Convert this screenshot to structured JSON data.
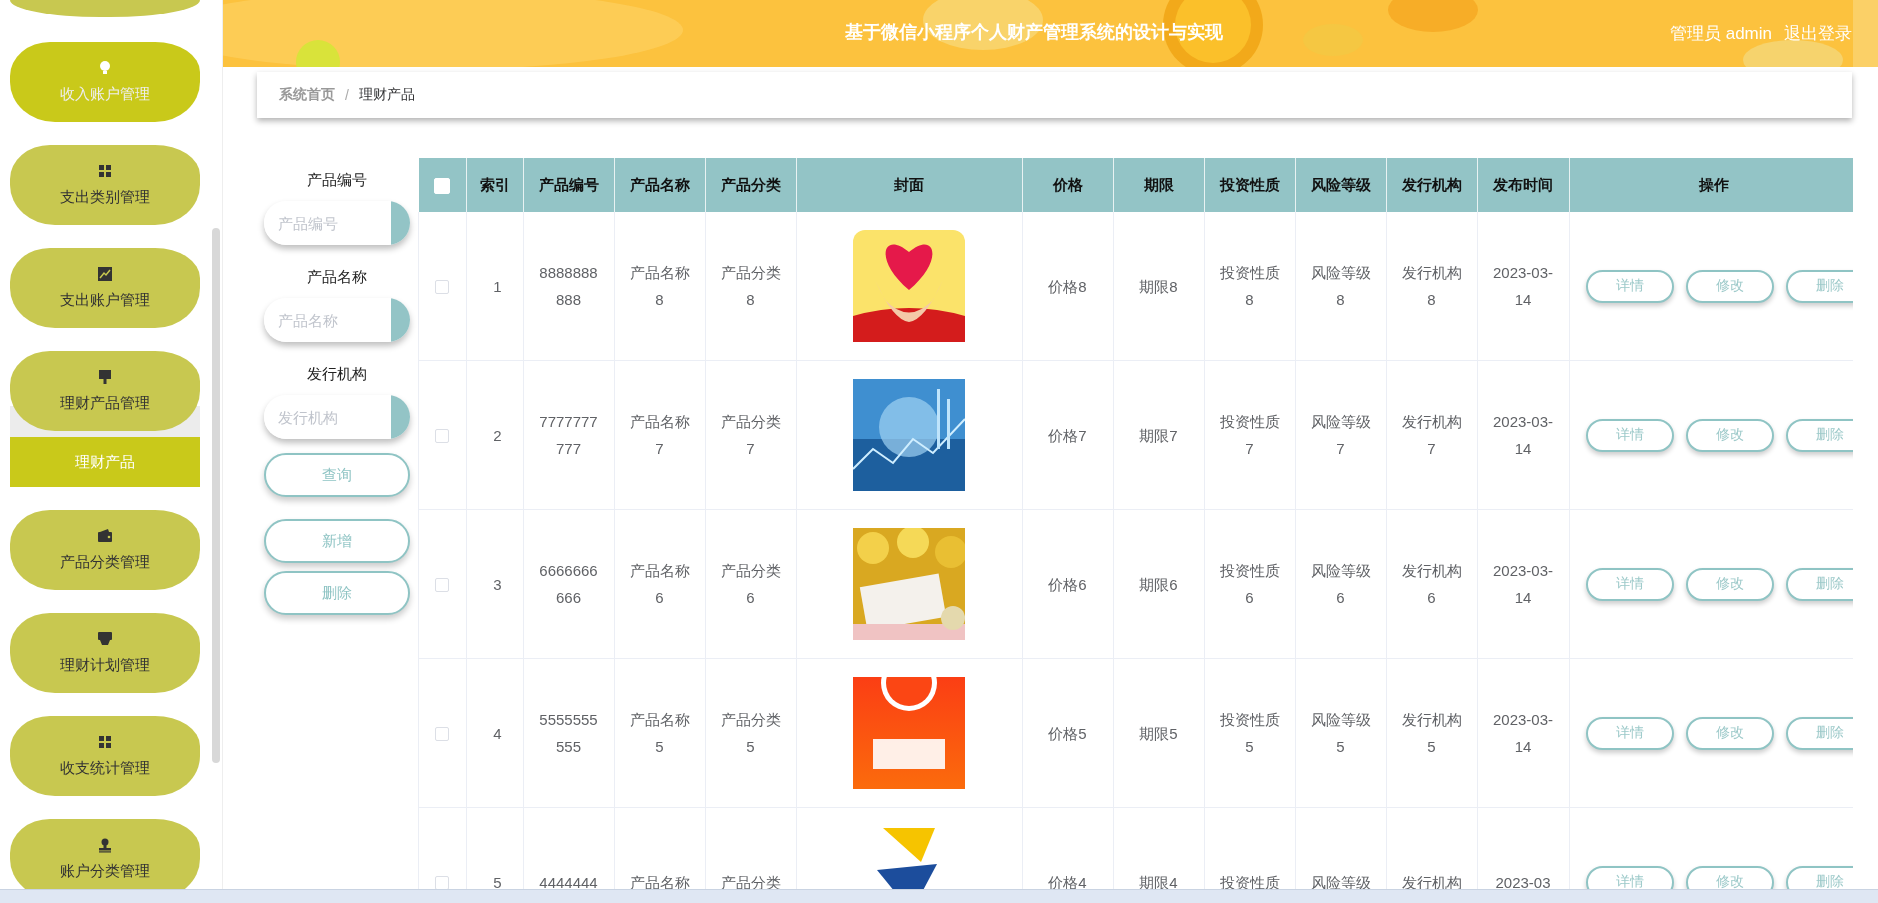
{
  "header": {
    "title": "基于微信小程序个人财产管理系统的设计与实现",
    "user": "管理员 admin",
    "logout": "退出登录"
  },
  "breadcrumb": [
    {
      "label": "系统首页",
      "current": false
    },
    {
      "label": "理财产品",
      "current": true
    }
  ],
  "breadcrumb_separator": "/",
  "sidebar": {
    "items": [
      {
        "label": "收入账户管理",
        "selected": true,
        "expanded": false
      },
      {
        "label": "支出类别管理",
        "selected": false,
        "expanded": false
      },
      {
        "label": "支出账户管理",
        "selected": false,
        "expanded": false
      },
      {
        "label": "理财产品管理",
        "selected": false,
        "expanded": true,
        "children": [
          {
            "label": "理财产品",
            "selected": true
          }
        ]
      },
      {
        "label": "产品分类管理",
        "selected": false,
        "expanded": false
      },
      {
        "label": "理财计划管理",
        "selected": false,
        "expanded": false
      },
      {
        "label": "收支统计管理",
        "selected": false,
        "expanded": false
      },
      {
        "label": "账户分类管理",
        "selected": false,
        "expanded": false
      }
    ]
  },
  "search": {
    "fields": [
      {
        "label": "产品编号",
        "placeholder": "产品编号"
      },
      {
        "label": "产品名称",
        "placeholder": "产品名称"
      },
      {
        "label": "发行机构",
        "placeholder": "发行机构"
      }
    ],
    "query_button": "查询",
    "buttons": [
      "新增",
      "删除"
    ]
  },
  "table": {
    "select_all": false,
    "columns": [
      {
        "kind": "check"
      },
      {
        "kind": "text",
        "label": "索引"
      },
      {
        "kind": "text",
        "label": "产品编号"
      },
      {
        "kind": "text",
        "label": "产品名称"
      },
      {
        "kind": "text",
        "label": "产品分类"
      },
      {
        "kind": "cover",
        "label": "封面"
      },
      {
        "kind": "text",
        "label": "价格"
      },
      {
        "kind": "text",
        "label": "期限"
      },
      {
        "kind": "text",
        "label": "投资性质"
      },
      {
        "kind": "text",
        "label": "风险等级"
      },
      {
        "kind": "text",
        "label": "发行机构"
      },
      {
        "kind": "text",
        "label": "发布时间"
      },
      {
        "kind": "actions",
        "label": "操作"
      }
    ],
    "rows": [
      {
        "selected": false,
        "cells": [
          "",
          "1",
          "8888888888",
          "产品名称8",
          "产品分类8",
          {
            "kind": "picture"
          },
          "价格8",
          "期限8",
          "投资性质8",
          "风险等级8",
          "发行机构8",
          "2023-03-14"
        ],
        "actions": [
          "详情",
          "修改",
          "删除"
        ]
      },
      {
        "selected": false,
        "cells": [
          "",
          "2",
          "7777777777",
          "产品名称7",
          "产品分类7",
          {
            "kind": "picture"
          },
          "价格7",
          "期限7",
          "投资性质7",
          "风险等级7",
          "发行机构7",
          "2023-03-14"
        ],
        "actions": [
          "详情",
          "修改",
          "删除"
        ]
      },
      {
        "selected": false,
        "cells": [
          "",
          "3",
          "6666666666",
          "产品名称6",
          "产品分类6",
          {
            "kind": "picture"
          },
          "价格6",
          "期限6",
          "投资性质6",
          "风险等级6",
          "发行机构6",
          "2023-03-14"
        ],
        "actions": [
          "详情",
          "修改",
          "删除"
        ]
      },
      {
        "selected": false,
        "cells": [
          "",
          "4",
          "5555555555",
          "产品名称5",
          "产品分类5",
          {
            "kind": "picture"
          },
          "价格5",
          "期限5",
          "投资性质5",
          "风险等级5",
          "发行机构5",
          "2023-03-14"
        ],
        "actions": [
          "详情",
          "修改",
          "删除"
        ]
      },
      {
        "selected": false,
        "cells": [
          "",
          "5",
          "4444444",
          "产品名称",
          "产品分类",
          {
            "kind": "picture"
          },
          "价格4",
          "期限4",
          "投资性质",
          "风险等级",
          "发行机构",
          "2023-03"
        ],
        "actions": [
          "详情",
          "修改",
          "删除"
        ]
      }
    ]
  }
}
